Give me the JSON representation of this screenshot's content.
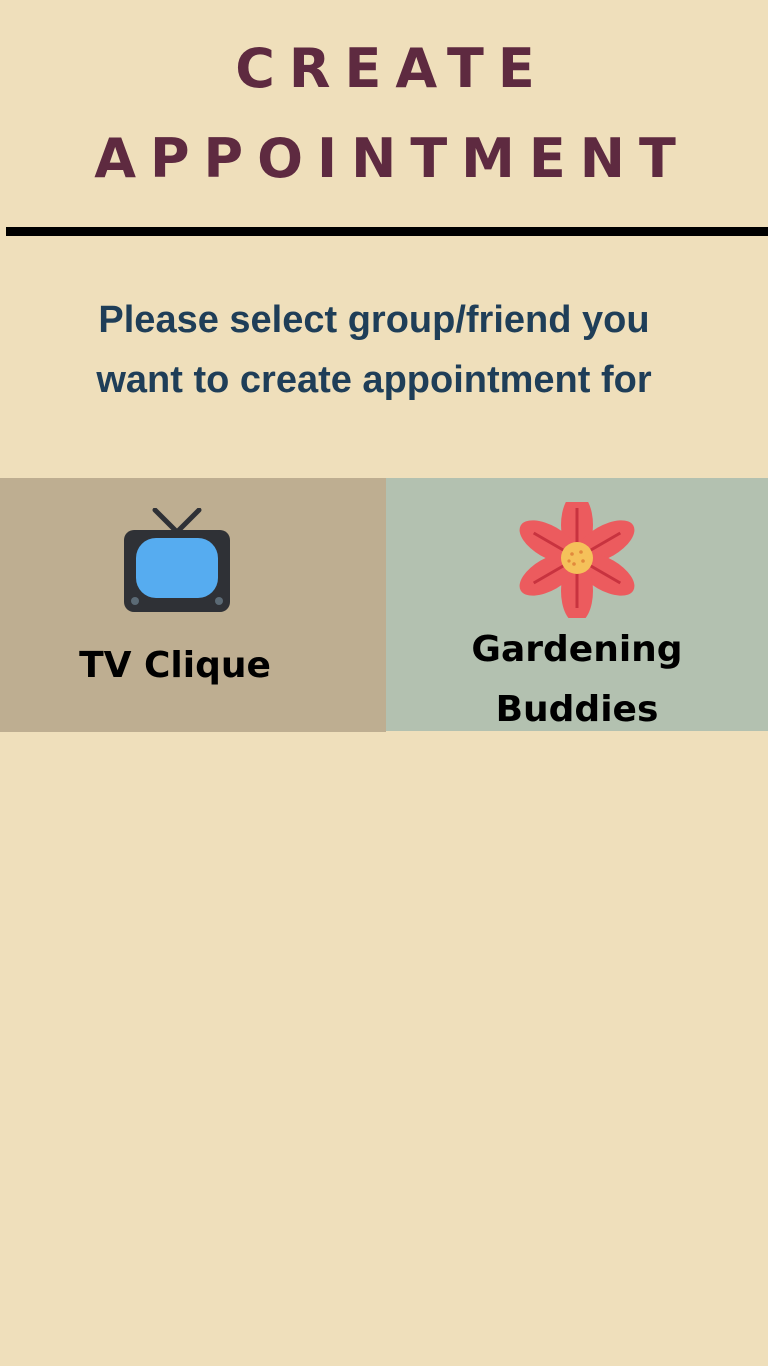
{
  "header": {
    "title_line_1": "CREATE",
    "title_line_2": "APPOINTMENT"
  },
  "instruction": {
    "line_1": "Please select group/friend you",
    "line_2": "want to create appointment for"
  },
  "groups": [
    {
      "label": "TV Clique",
      "icon": "tv-icon",
      "color": "#beae91"
    },
    {
      "label_line_1": "Gardening",
      "label_line_2": "Buddies",
      "icon": "flower-icon",
      "color": "#b3c1b0"
    }
  ],
  "colors": {
    "background": "#efdfbb",
    "title": "#5e2a40",
    "instruction": "#1f3e58",
    "divider": "#000000"
  }
}
